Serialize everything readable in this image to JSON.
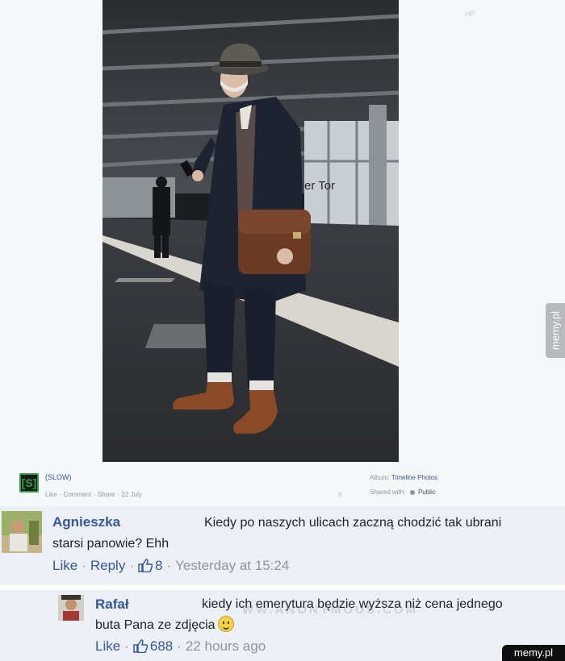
{
  "photo": {
    "alt": "Elderly man in hat and dark coat holding a leather bag on a train platform",
    "platform_sign": "er Tor",
    "corner_mark": "HP"
  },
  "post": {
    "page_name": "(SLOW)",
    "page_logo": "[S]",
    "like": "Like",
    "comment": "Comment",
    "share": "Share",
    "date": "22 July",
    "album_label": "Album:",
    "album_value": "Timeline Photos",
    "shared_label": "Shared with:",
    "shared_value": "Public",
    "hash_mark": "ȣ"
  },
  "comments": [
    {
      "author": "Agnieszka",
      "text_line1": "Kiedy po naszych ulicach zaczną chodzić tak ubrani",
      "text_line2": "starsi panowie? Ehh",
      "like_label": "Like",
      "reply_label": "Reply",
      "like_count": "8",
      "timestamp": "Yesterday at 15:24"
    },
    {
      "author": "Rafał",
      "text_line1": "kiedy ich emerytura będzie wyższa niż cena jednego",
      "text_line2": "buta Pana ze zdjęcia",
      "like_label": "Like",
      "like_count": "688",
      "timestamp": "22 hours ago"
    }
  ],
  "watermarks": {
    "side_tab": "memy.pl",
    "corner_badge": "memy.pl",
    "overlay": "WW.ANONYMOUS.COM"
  },
  "colors": {
    "link": "#365899",
    "meta_text": "#90949c",
    "comment_bg": "#eceff4"
  }
}
